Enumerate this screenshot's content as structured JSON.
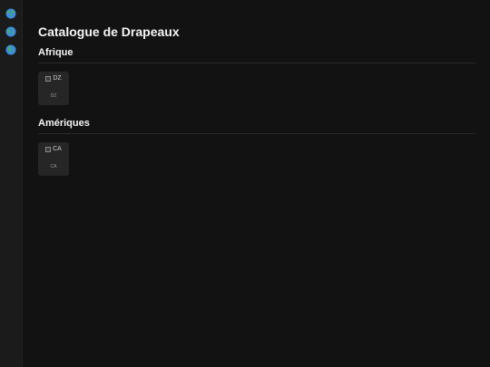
{
  "sidebar": {
    "items": [
      {
        "icon": "globe-icon"
      },
      {
        "icon": "globe-icon"
      },
      {
        "icon": "globe-icon"
      }
    ]
  },
  "page": {
    "title": "Catalogue de Drapeaux"
  },
  "regions": [
    {
      "title": "Afrique",
      "flags": [
        {
          "alt": "DZ",
          "code": "DZ"
        }
      ]
    },
    {
      "title": "Amériques",
      "flags": [
        {
          "alt": "CA",
          "code": "CA"
        }
      ]
    }
  ]
}
